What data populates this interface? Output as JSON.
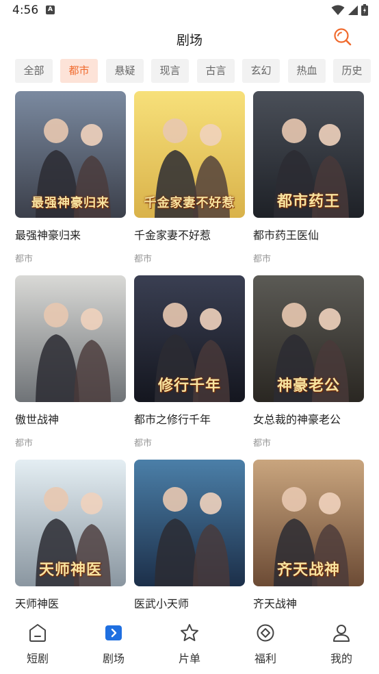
{
  "status": {
    "time": "4:56",
    "notif_icon": "A"
  },
  "header": {
    "title": "剧场",
    "search_icon": "search-icon",
    "accent": "#f06a2d"
  },
  "categories": [
    {
      "label": "全部",
      "active": false
    },
    {
      "label": "都市",
      "active": true
    },
    {
      "label": "悬疑",
      "active": false
    },
    {
      "label": "现言",
      "active": false
    },
    {
      "label": "古言",
      "active": false
    },
    {
      "label": "玄幻",
      "active": false
    },
    {
      "label": "热血",
      "active": false
    },
    {
      "label": "历史",
      "active": false
    }
  ],
  "dramas": [
    {
      "title": "最强神豪归来",
      "tag": "都市",
      "poster_text": "最强神豪归来",
      "bg": [
        "#7b8aa0",
        "#3b3f4a"
      ]
    },
    {
      "title": "千金家妻不好惹",
      "tag": "都市",
      "poster_text": "千金家妻不好惹",
      "bg": [
        "#f7e07a",
        "#d9b24a"
      ]
    },
    {
      "title": "都市药王医仙",
      "tag": "都市",
      "poster_text": "都市药王",
      "bg": [
        "#4a4f58",
        "#1e2127"
      ]
    },
    {
      "title": "傲世战神",
      "tag": "都市",
      "poster_text": "",
      "bg": [
        "#d9d9d6",
        "#6f7377"
      ]
    },
    {
      "title": "都市之修行千年",
      "tag": "都市",
      "poster_text": "修行千年",
      "bg": [
        "#3a3f52",
        "#14161f"
      ]
    },
    {
      "title": "女总裁的神豪老公",
      "tag": "都市",
      "poster_text": "神豪老公",
      "bg": [
        "#5b5a55",
        "#2a2722"
      ]
    },
    {
      "title": "天师神医",
      "tag": "",
      "poster_text": "天师神医",
      "bg": [
        "#e4eef3",
        "#8a96a0"
      ]
    },
    {
      "title": "医武小天师",
      "tag": "",
      "poster_text": "",
      "bg": [
        "#4b7fa8",
        "#1c2f49"
      ]
    },
    {
      "title": "齐天战神",
      "tag": "",
      "poster_text": "齐天战神",
      "bg": [
        "#c9a57e",
        "#6c4b35"
      ]
    }
  ],
  "nav": [
    {
      "label": "短剧",
      "icon": "short-drama-icon",
      "active": false
    },
    {
      "label": "剧场",
      "icon": "theater-icon",
      "active": true
    },
    {
      "label": "片单",
      "icon": "star-icon",
      "active": false
    },
    {
      "label": "福利",
      "icon": "welfare-icon",
      "active": false
    },
    {
      "label": "我的",
      "icon": "profile-icon",
      "active": false
    }
  ]
}
